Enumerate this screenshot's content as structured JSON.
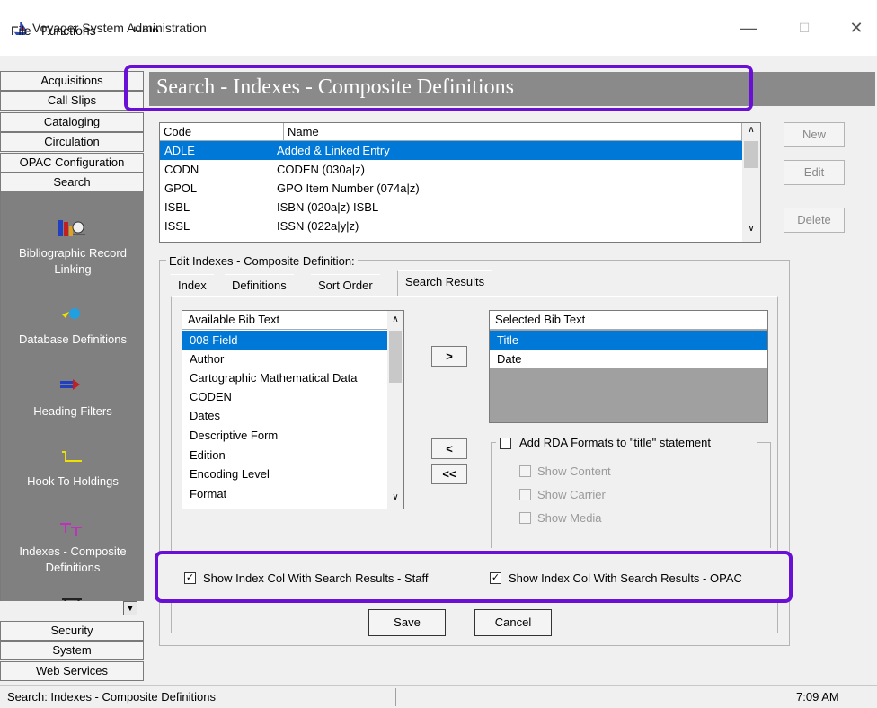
{
  "window": {
    "title": "Voyager System Administration",
    "minimize": "—",
    "maximize": "☐",
    "close": "✕"
  },
  "menu": [
    "File",
    "Functions",
    "Help"
  ],
  "nav_top": [
    "Acquisitions",
    "Call Slips",
    "Cataloging",
    "Circulation",
    "OPAC Configuration",
    "Search"
  ],
  "nav_items": [
    {
      "label": "Bibliographic Record\nLinking",
      "icon": "bib-link-icon"
    },
    {
      "label": "Database Definitions",
      "icon": "database-icon"
    },
    {
      "label": "Heading Filters",
      "icon": "filter-icon"
    },
    {
      "label": "Hook To Holdings",
      "icon": "hook-icon"
    },
    {
      "label": "Indexes - Composite\nDefinitions",
      "icon": "indexes-icon"
    }
  ],
  "nav_bottom": [
    "Security",
    "System",
    "Web Services"
  ],
  "header": {
    "title": "Search - Indexes - Composite Definitions"
  },
  "table": {
    "columns": [
      "Code",
      "Name"
    ],
    "rows": [
      {
        "code": "ADLE",
        "name": "Added & Linked Entry",
        "selected": true
      },
      {
        "code": "CODN",
        "name": "CODEN (030a|z)"
      },
      {
        "code": "GPOL",
        "name": "GPO Item Number (074a|z)"
      },
      {
        "code": "ISBL",
        "name": "ISBN (020a|z) ISBL"
      },
      {
        "code": "ISSL",
        "name": "ISSN (022a|y|z)"
      }
    ]
  },
  "side_buttons": {
    "new": "New",
    "edit": "Edit",
    "delete": "Delete"
  },
  "edit_group": {
    "label": "Edit Indexes - Composite Definition:",
    "tabs": [
      "Index",
      "Definitions",
      "Sort Order",
      "Search Results"
    ],
    "active_tab": "Search Results"
  },
  "available": {
    "header": "Available Bib Text",
    "items": [
      "008 Field",
      "Author",
      "Cartographic Mathematical Data",
      "CODEN",
      "Dates",
      "Descriptive Form",
      "Edition",
      "Encoding Level",
      "Format"
    ],
    "selected": "008 Field"
  },
  "selected_list": {
    "header": "Selected Bib Text",
    "items": [
      "Title",
      "Date"
    ],
    "selected": "Title"
  },
  "move_buttons": {
    "add": ">",
    "remove": "<",
    "remove_all": "<<"
  },
  "rda": {
    "label": "Add RDA Formats to \"title\" statement",
    "options": [
      "Show Content",
      "Show Carrier",
      "Show Media"
    ]
  },
  "show_index": {
    "staff": "Show Index Col With Search Results - Staff",
    "opac": "Show Index Col With Search Results - OPAC",
    "staff_checked": true,
    "opac_checked": true
  },
  "actions": {
    "save": "Save",
    "cancel": "Cancel"
  },
  "statusbar": {
    "text": "Search:  Indexes - Composite Definitions",
    "time": "7:09 AM"
  },
  "colors": {
    "selection": "#0078d7",
    "highlight": "#6a0fd6",
    "nav_bg": "#808080",
    "header_bg": "#8a8a8a"
  }
}
